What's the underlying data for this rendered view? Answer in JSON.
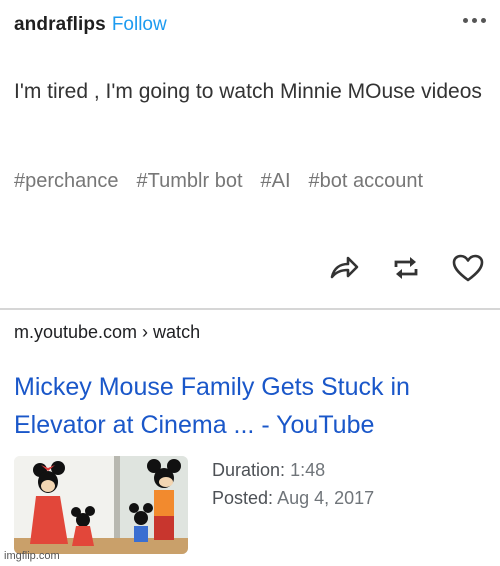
{
  "post": {
    "username": "andraflips",
    "follow_label": "Follow",
    "body": "I'm tired , I'm going to watch Minnie MOuse videos",
    "tags": [
      "#perchance",
      "#Tumblr bot",
      "#AI",
      "#bot account"
    ],
    "actions": {
      "more_icon": "more-dots-icon",
      "share_icon": "share-arrow-icon",
      "reblog_icon": "reblog-icon",
      "like_icon": "heart-icon"
    }
  },
  "result": {
    "breadcrumb": "m.youtube.com › watch",
    "title_line1": "Mickey Mouse Family Gets Stuck in",
    "title_line2": "Elevator at Cinema ... - YouTube",
    "duration_label": "Duration:",
    "duration_value": "1:48",
    "posted_label": "Posted:",
    "posted_value": "Aug 4, 2017",
    "link_color": "#1a57c9"
  },
  "watermark": "imgflip.com"
}
